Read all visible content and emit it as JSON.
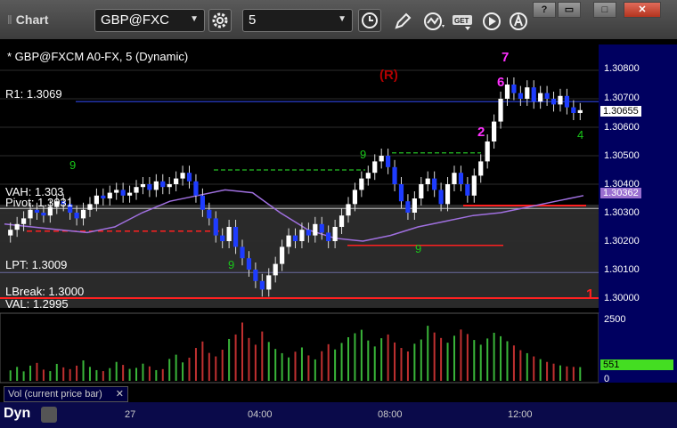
{
  "window": {
    "title": "Chart",
    "symbol": "GBP@FXC",
    "interval": "5",
    "buttons": [
      "?",
      "▭",
      "□",
      "✕"
    ]
  },
  "chart": {
    "instrument_line": "* GBP@FXCM A0-FX, 5 (Dynamic)",
    "r1_label": "R1: 1.3069",
    "vah_label": "VAH: 1.303",
    "pivot_label": "Pivot: 1.3031",
    "lpt_label": "LPT: 1.3009",
    "lbreak_label": "LBreak: 1.3000",
    "val_label": "VAL: 1.2995",
    "r_marker": "(R)",
    "last_price": "1.30655",
    "ma_price": "1.30362",
    "seq_7": "7",
    "seq_6": "6",
    "seq_2": "2",
    "seq_1": "1"
  },
  "price_axis": {
    "ticks": [
      "1.30800",
      "1.30700",
      "1.30600",
      "1.30500",
      "1.30400",
      "1.30300",
      "1.30200",
      "1.30100",
      "1.30000"
    ]
  },
  "volume": {
    "label": "Vol (current price bar)",
    "tick_max": "2500",
    "tick_min": "0",
    "current": "551"
  },
  "time_axis": {
    "labels": [
      "27",
      "04:00",
      "08:00",
      "12:00"
    ]
  },
  "footer": {
    "dyn": "Dyn"
  },
  "colors": {
    "up_candle": "#ffffff",
    "down_candle": "#1e3cff",
    "r1_line": "#2233aa",
    "pivot_line": "#c0c0c0",
    "stop_line": "#ff2020",
    "purple_ma": "#a070e0",
    "green_count": "#19c719",
    "magenta_count": "#ff30ff"
  },
  "chart_data": {
    "type": "candlestick",
    "symbol": "GBP@FXCM",
    "interval": "5",
    "y_range": [
      1.2995,
      1.3085
    ],
    "closes": [
      1.3024,
      1.3026,
      1.3028,
      1.3031,
      1.303,
      1.3029,
      1.3032,
      1.3034,
      1.3033,
      1.303,
      1.3028,
      1.3031,
      1.3033,
      1.3036,
      1.3035,
      1.3037,
      1.3038,
      1.3036,
      1.3037,
      1.3039,
      1.304,
      1.3038,
      1.3041,
      1.3039,
      1.304,
      1.3042,
      1.3044,
      1.3041,
      1.3036,
      1.3031,
      1.3028,
      1.3022,
      1.302,
      1.3025,
      1.3018,
      1.3014,
      1.301,
      1.3006,
      1.3003,
      1.3008,
      1.3012,
      1.3018,
      1.3022,
      1.302,
      1.3024,
      1.3022,
      1.3026,
      1.3023,
      1.302,
      1.3025,
      1.3029,
      1.3033,
      1.3038,
      1.3042,
      1.3044,
      1.3048,
      1.305,
      1.3046,
      1.304,
      1.3034,
      1.303,
      1.3035,
      1.304,
      1.3042,
      1.3038,
      1.3033,
      1.304,
      1.3044,
      1.304,
      1.3036,
      1.3043,
      1.3048,
      1.3055,
      1.3062,
      1.307,
      1.3075,
      1.3072,
      1.307,
      1.3074,
      1.3069,
      1.3072,
      1.307,
      1.3068,
      1.3071,
      1.3067,
      1.3065,
      1.3066
    ],
    "volume": [
      420,
      560,
      380,
      610,
      720,
      450,
      390,
      680,
      540,
      470,
      610,
      820,
      560,
      430,
      390,
      510,
      760,
      640,
      480,
      520,
      690,
      580,
      430,
      470,
      880,
      1050,
      740,
      930,
      1320,
      1580,
      1120,
      980,
      1250,
      1680,
      1860,
      2340,
      1720,
      1450,
      1980,
      1560,
      1280,
      1110,
      940,
      1170,
      1340,
      1020,
      860,
      1190,
      1470,
      1260,
      1520,
      1750,
      1910,
      2050,
      1620,
      1380,
      1710,
      1860,
      1540,
      1320,
      1180,
      1490,
      1660,
      2210,
      1940,
      1720,
      1530,
      1810,
      2060,
      1880,
      1640,
      1450,
      1700,
      1930,
      1790,
      1590,
      1420,
      1230,
      1110,
      980,
      870,
      760,
      690,
      620,
      580,
      560,
      551
    ],
    "volume_range": [
      0,
      2500
    ]
  }
}
